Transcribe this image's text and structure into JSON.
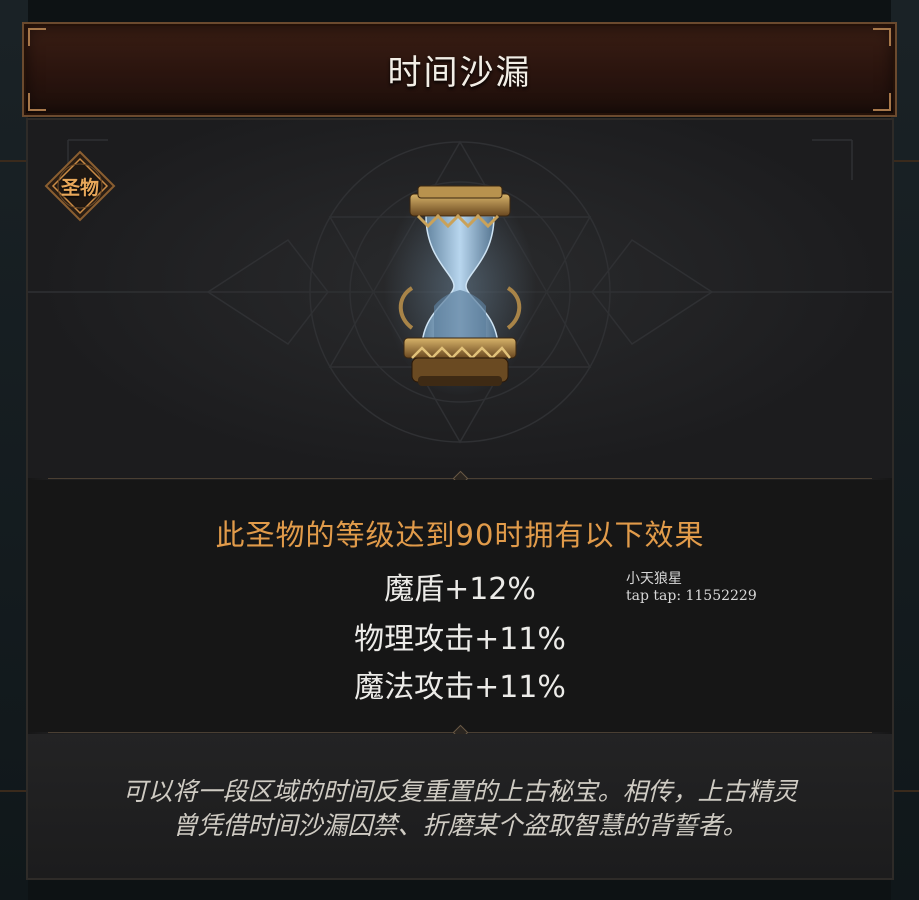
{
  "item": {
    "name": "时间沙漏",
    "category_badge": "圣物"
  },
  "effects": {
    "title": "此圣物的等级达到90时拥有以下效果",
    "stats": [
      "魔盾+12%",
      "物理攻击+11%",
      "魔法攻击+11%"
    ]
  },
  "watermark": {
    "line1": "小天狼星",
    "line2": "tap tap: 11552229"
  },
  "lore": {
    "line1": "可以将一段区域的时间反复重置的上古秘宝。相传，上古精灵",
    "line2": "曾凭借时间沙漏囚禁、折磨某个盗取智慧的背誓者。"
  },
  "colors": {
    "effect_title": "#e19b4a",
    "badge": "#e9a85a",
    "title_bar": "#2a140e"
  }
}
